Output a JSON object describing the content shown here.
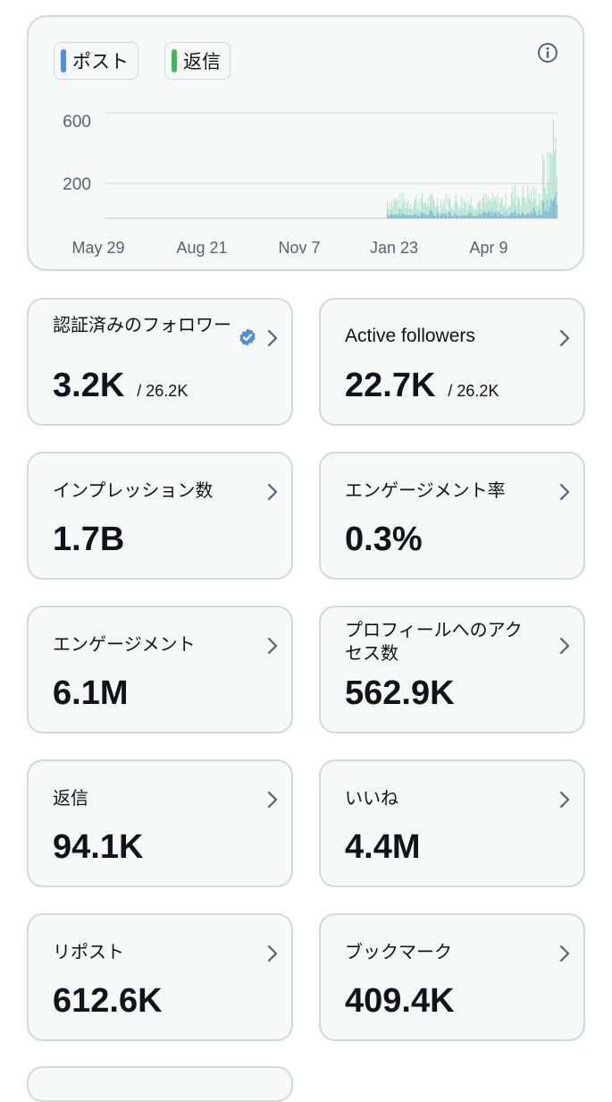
{
  "legend": {
    "posts_label": "ポスト",
    "replies_label": "返信",
    "posts_color": "#4a90e2",
    "replies_color": "#3fb950"
  },
  "chart_data": {
    "type": "bar",
    "x_tick_labels": [
      "May 29",
      "Aug 21",
      "Nov 7",
      "Jan 23",
      "Apr 9"
    ],
    "y_tick_labels": [
      "600",
      "200"
    ],
    "y_ticks": [
      600,
      200
    ],
    "ylim": [
      0,
      640
    ],
    "series": [
      {
        "color": "#4a90e2"
      },
      {
        "color": "#9fe0c4"
      }
    ],
    "values_estimated": {
      "Jan 23": 100,
      "Apr 9": 120,
      "end": 560
    }
  },
  "cards": [
    {
      "label": "認証済みのフォロワー",
      "value": "3.2K",
      "total": "/ 26.2K",
      "verified": true
    },
    {
      "label": "Active followers",
      "value": "22.7K",
      "total": "/ 26.2K"
    },
    {
      "label": "インプレッション数",
      "value": "1.7B"
    },
    {
      "label": "エンゲージメント率",
      "value": "0.3%"
    },
    {
      "label": "エンゲージメント",
      "value": "6.1M"
    },
    {
      "label": "プロフィールへのアクセス数",
      "value": "562.9K"
    },
    {
      "label": "返信",
      "value": "94.1K"
    },
    {
      "label": "いいね",
      "value": "4.4M"
    },
    {
      "label": "リポスト",
      "value": "612.6K"
    },
    {
      "label": "ブックマーク",
      "value": "409.4K"
    }
  ]
}
